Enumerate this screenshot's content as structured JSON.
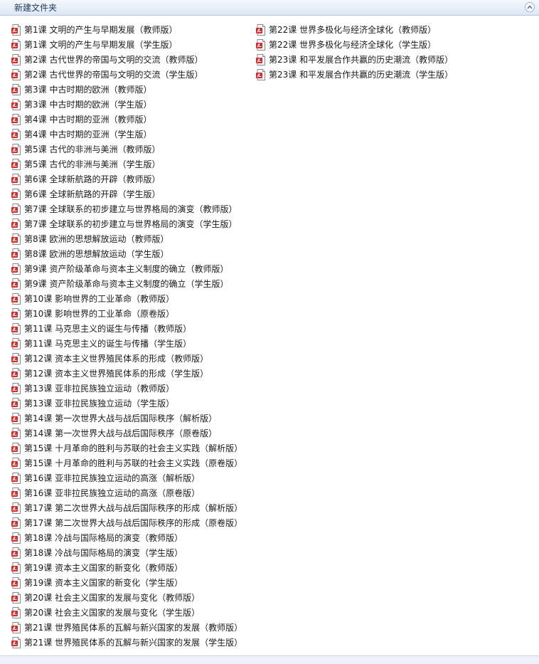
{
  "window": {
    "title": "新建文件夹"
  },
  "files_left": [
    {
      "name": "第1课 文明的产生与早期发展（教师版）",
      "icon": "pdf-icon"
    },
    {
      "name": "第1课 文明的产生与早期发展（学生版）",
      "icon": "pdf-icon"
    },
    {
      "name": "第2课 古代世界的帝国与文明的交流（教师版）",
      "icon": "pdf-icon"
    },
    {
      "name": "第2课 古代世界的帝国与文明的交流（学生版）",
      "icon": "pdf-icon"
    },
    {
      "name": "第3课 中古时期的欧洲（教师版）",
      "icon": "pdf-icon"
    },
    {
      "name": "第3课 中古时期的欧洲（学生版）",
      "icon": "pdf-icon"
    },
    {
      "name": "第4课 中古时期的亚洲（教师版）",
      "icon": "pdf-icon"
    },
    {
      "name": "第4课 中古时期的亚洲（学生版）",
      "icon": "pdf-icon"
    },
    {
      "name": "第5课 古代的非洲与美洲（教师版）",
      "icon": "pdf-icon"
    },
    {
      "name": "第5课 古代的非洲与美洲（学生版）",
      "icon": "pdf-icon"
    },
    {
      "name": "第6课 全球新航路的开辟（教师版）",
      "icon": "pdf-icon"
    },
    {
      "name": "第6课 全球新航路的开辟（学生版）",
      "icon": "pdf-icon"
    },
    {
      "name": "第7课 全球联系的初步建立与世界格局的演变（教师版）",
      "icon": "pdf-icon"
    },
    {
      "name": "第7课 全球联系的初步建立与世界格局的演变（学生版）",
      "icon": "pdf-icon"
    },
    {
      "name": "第8课 欧洲的思想解放运动（教师版）",
      "icon": "pdf-icon"
    },
    {
      "name": "第8课 欧洲的思想解放运动（学生版）",
      "icon": "pdf-icon"
    },
    {
      "name": "第9课 资产阶级革命与资本主义制度的确立（教师版）",
      "icon": "pdf-icon"
    },
    {
      "name": "第9课 资产阶级革命与资本主义制度的确立（学生版）",
      "icon": "pdf-icon"
    },
    {
      "name": "第10课 影响世界的工业革命（教师版）",
      "icon": "pdf-icon"
    },
    {
      "name": "第10课 影响世界的工业革命（原卷版）",
      "icon": "pdf-icon"
    },
    {
      "name": "第11课 马克思主义的诞生与传播（教师版）",
      "icon": "pdf-icon"
    },
    {
      "name": "第11课 马克思主义的诞生与传播（学生版）",
      "icon": "pdf-icon"
    },
    {
      "name": "第12课 资本主义世界殖民体系的形成（教师版）",
      "icon": "pdf-icon"
    },
    {
      "name": "第12课 资本主义世界殖民体系的形成（学生版）",
      "icon": "pdf-icon"
    },
    {
      "name": "第13课 亚非拉民族独立运动（教师版）",
      "icon": "pdf-icon"
    },
    {
      "name": "第13课 亚非拉民族独立运动（学生版）",
      "icon": "pdf-icon"
    },
    {
      "name": "第14课 第一次世界大战与战后国际秩序（解析版）",
      "icon": "pdf-icon"
    },
    {
      "name": "第14课 第一次世界大战与战后国际秩序（原卷版）",
      "icon": "pdf-icon"
    },
    {
      "name": "第15课 十月革命的胜利与苏联的社会主义实践（解析版）",
      "icon": "pdf-icon"
    },
    {
      "name": "第15课 十月革命的胜利与苏联的社会主义实践（原卷版）",
      "icon": "pdf-icon"
    },
    {
      "name": "第16课 亚非拉民族独立运动的高涨（解析版）",
      "icon": "pdf-icon"
    },
    {
      "name": "第16课 亚非拉民族独立运动的高涨（原卷版）",
      "icon": "pdf-icon"
    },
    {
      "name": "第17课 第二次世界大战与战后国际秩序的形成（解析版）",
      "icon": "pdf-icon"
    },
    {
      "name": "第17课 第二次世界大战与战后国际秩序的形成（原卷版）",
      "icon": "pdf-icon"
    },
    {
      "name": "第18课 冷战与国际格局的演变（教师版）",
      "icon": "pdf-icon"
    },
    {
      "name": "第18课 冷战与国际格局的演变（学生版）",
      "icon": "pdf-icon"
    },
    {
      "name": "第19课 资本主义国家的新变化（教师版）",
      "icon": "pdf-icon"
    },
    {
      "name": "第19课 资本主义国家的新变化（学生版）",
      "icon": "pdf-icon"
    },
    {
      "name": "第20课 社会主义国家的发展与变化（教师版）",
      "icon": "pdf-icon"
    },
    {
      "name": "第20课 社会主义国家的发展与变化（学生版）",
      "icon": "pdf-icon"
    },
    {
      "name": "第21课 世界殖民体系的瓦解与新兴国家的发展（教师版）",
      "icon": "pdf-icon"
    },
    {
      "name": "第21课 世界殖民体系的瓦解与新兴国家的发展（学生版）",
      "icon": "pdf-icon"
    }
  ],
  "files_right": [
    {
      "name": "第22课 世界多极化与经济全球化（教师版）",
      "icon": "pdf-icon"
    },
    {
      "name": "第22课 世界多极化与经济全球化（学生版）",
      "icon": "pdf-icon"
    },
    {
      "name": "第23课 和平发展合作共赢的历史潮流（教师版）",
      "icon": "pdf-icon"
    },
    {
      "name": "第23课 和平发展合作共赢的历史潮流（学生版）",
      "icon": "pdf-icon"
    }
  ],
  "colors": {
    "pdf_icon_red": "#d42a2a",
    "title_text": "#1e395b",
    "header_bg": "#dde8f5"
  }
}
